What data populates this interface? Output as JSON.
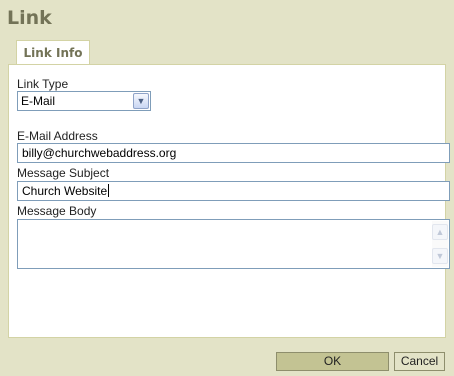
{
  "dialog": {
    "title": "Link",
    "tabs": [
      {
        "label": "Link Info"
      }
    ],
    "link_type": {
      "label": "Link Type",
      "selected": "E-Mail"
    },
    "email_address": {
      "label": "E-Mail Address",
      "value": "billy@churchwebaddress.org"
    },
    "message_subject": {
      "label": "Message Subject",
      "value": "Church Website"
    },
    "message_body": {
      "label": "Message Body",
      "value": ""
    },
    "buttons": {
      "ok": "OK",
      "cancel": "Cancel"
    }
  },
  "icons": {
    "dropdown": "chevron-down-icon",
    "scroll_up": "scroll-up-icon",
    "scroll_down": "scroll-down-icon"
  },
  "colors": {
    "chrome": "#e3e3c7",
    "title": "#737357",
    "ok_button": "#c3c393"
  }
}
